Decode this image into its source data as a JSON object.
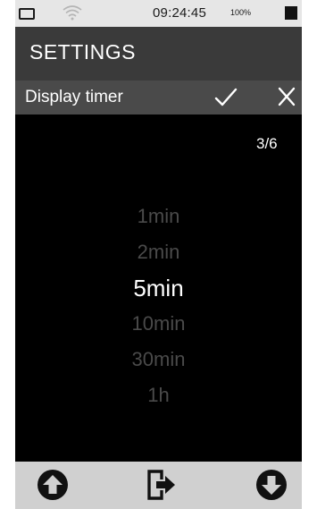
{
  "status_bar": {
    "time": "09:24:45",
    "battery_percent": "100%",
    "wifi_icon": "wifi-icon",
    "battery_icon": "battery-icon"
  },
  "header": {
    "title": "SETTINGS"
  },
  "sub_header": {
    "setting_name": "Display timer",
    "confirm_icon": "checkmark-icon",
    "cancel_icon": "close-icon"
  },
  "content": {
    "page_indicator": "3/6",
    "options": [
      "1min",
      "2min",
      "5min",
      "10min",
      "30min",
      "1h"
    ],
    "selected_option": "5min"
  },
  "bottom_bar": {
    "buttons": [
      "arrow-up-circle-icon",
      "exit-icon",
      "arrow-down-circle-icon"
    ]
  },
  "colors": {
    "background": "#000000",
    "title_bar": "#3a3a3a",
    "sub_header": "#4a4a4a",
    "bottom_bar": "#d0d0d0",
    "selected_text": "#ffffff",
    "dimmed_text": "#4a4a4a"
  }
}
